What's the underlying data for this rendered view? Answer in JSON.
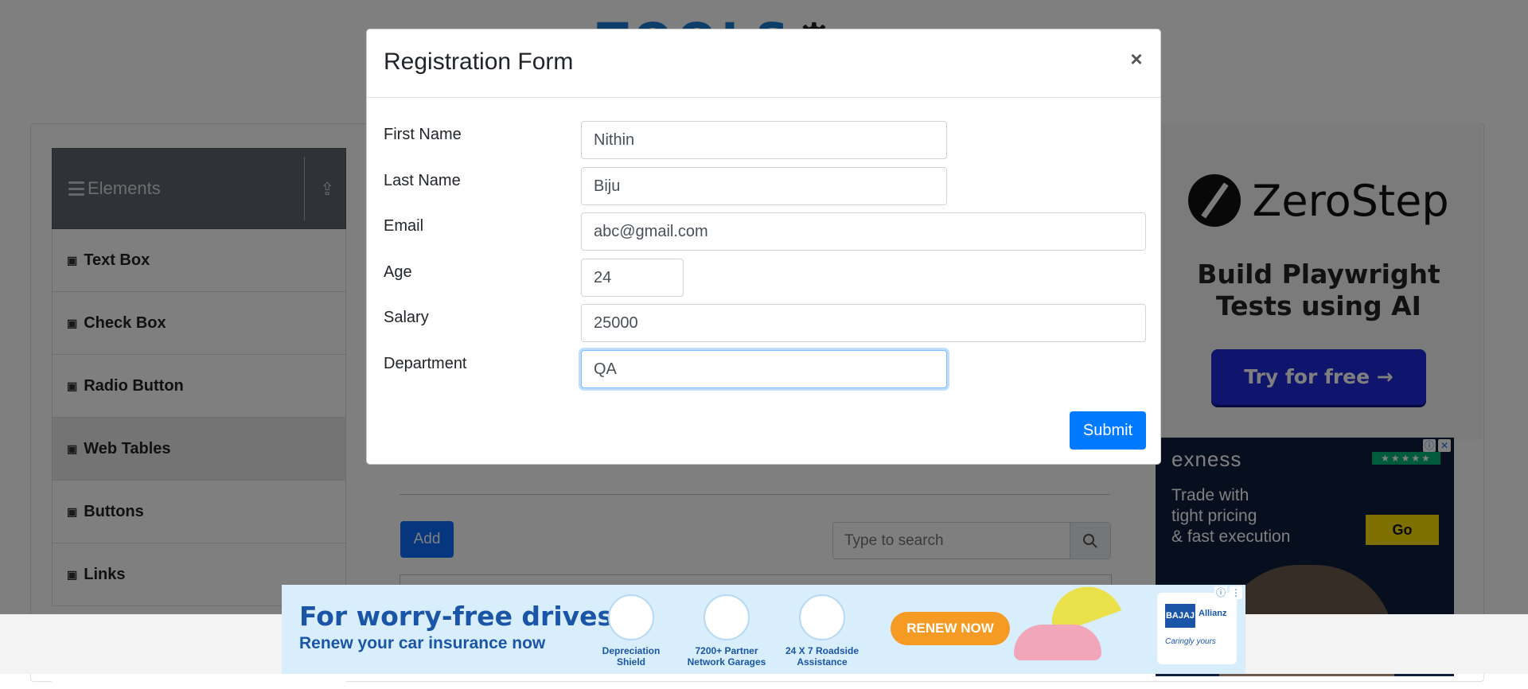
{
  "background": {
    "sidebar": {
      "group_title": "Elements",
      "items": [
        {
          "label": "Text Box",
          "active": false
        },
        {
          "label": "Check Box",
          "active": false
        },
        {
          "label": "Radio Button",
          "active": false
        },
        {
          "label": "Web Tables",
          "active": true
        },
        {
          "label": "Buttons",
          "active": false
        },
        {
          "label": "Links",
          "active": false
        }
      ]
    },
    "main": {
      "add_label": "Add",
      "search_placeholder": "Type to search"
    }
  },
  "ads": {
    "zerostep": {
      "brand": "ZeroStep",
      "headline_line1": "Build Playwright",
      "headline_line2": "Tests using AI",
      "cta": "Try for free →"
    },
    "exness": {
      "brand": "exness",
      "tagline_line1": "Trade with",
      "tagline_line2": "tight pricing",
      "tagline_line3": "& fast execution",
      "cta": "Go"
    },
    "insurance": {
      "headline": "For worry-free drives,",
      "subline": "Renew your car insurance now",
      "features": [
        {
          "line1": "Depreciation",
          "line2": "Shield"
        },
        {
          "line1": "7200+ Partner",
          "line2": "Network Garages"
        },
        {
          "line1": "24 X 7 Roadside",
          "line2": "Assistance"
        }
      ],
      "cta": "RENEW NOW",
      "brand": "BAJAJ",
      "partner": "Allianz",
      "slogan": "Caringly yours"
    }
  },
  "modal": {
    "title": "Registration Form",
    "close_glyph": "×",
    "fields": {
      "first_name": {
        "label": "First Name",
        "value": "Nithin"
      },
      "last_name": {
        "label": "Last Name",
        "value": "Biju"
      },
      "email": {
        "label": "Email",
        "value": "abc@gmail.com"
      },
      "age": {
        "label": "Age",
        "value": "24"
      },
      "salary": {
        "label": "Salary",
        "value": "25000"
      },
      "department": {
        "label": "Department",
        "value": "QA"
      }
    },
    "submit_label": "Submit"
  },
  "colors": {
    "primary": "#007bff",
    "overlay": "rgba(0,0,0,0.5)",
    "sidebar_header": "#5f6670"
  }
}
